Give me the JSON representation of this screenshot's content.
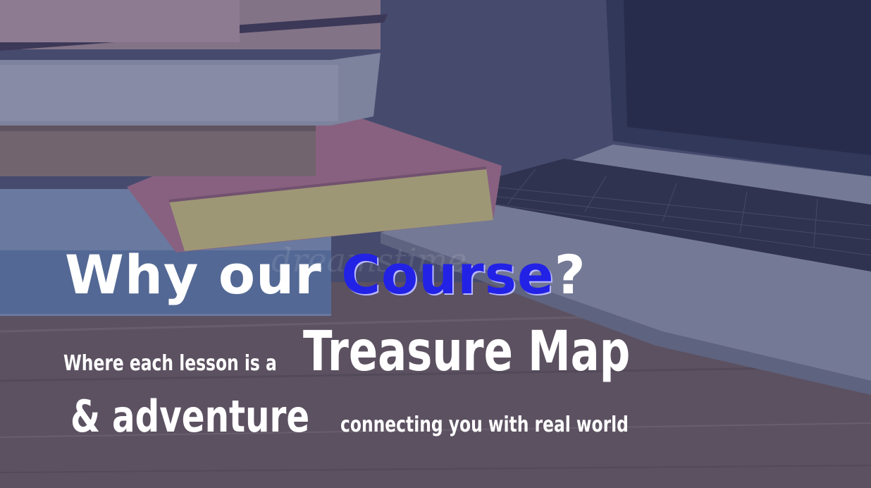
{
  "headline": {
    "prefix": "Why our",
    "highlight": "Course",
    "suffix": "?"
  },
  "tagline": {
    "part1": "Where each lesson is a",
    "part2": "Treasure Map",
    "part3": "& adventure",
    "part4": "connecting you with real world"
  },
  "watermark": "dreamstime",
  "colors": {
    "overlay": "#3a3f6a",
    "highlight": "#2222e6",
    "text": "#ffffff"
  }
}
